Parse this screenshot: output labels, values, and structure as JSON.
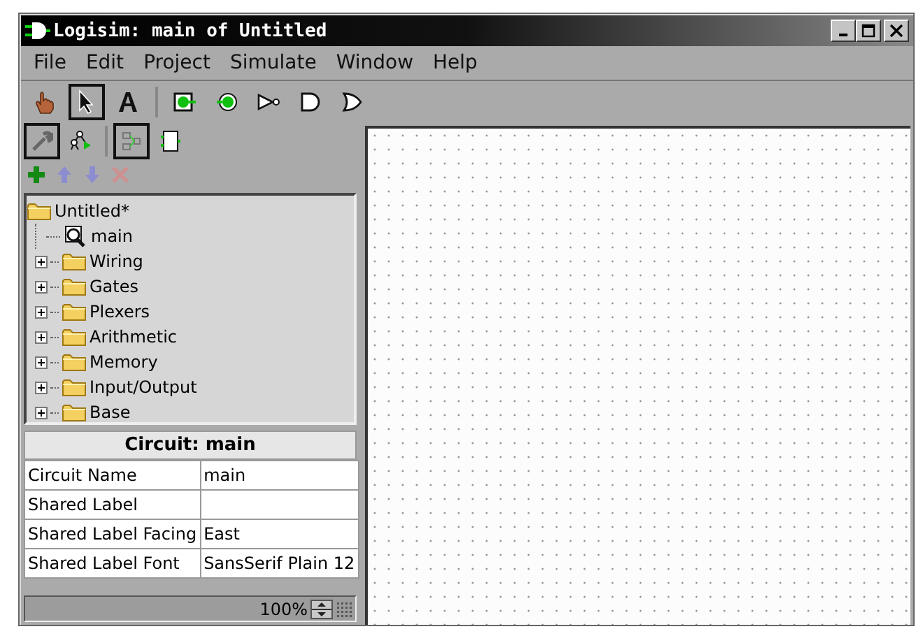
{
  "window": {
    "title": "Logisim: main of Untitled"
  },
  "menu": [
    "File",
    "Edit",
    "Project",
    "Simulate",
    "Window",
    "Help"
  ],
  "toolbar": [
    {
      "kind": "poke",
      "selected": false
    },
    {
      "kind": "select",
      "selected": true
    },
    {
      "kind": "text",
      "selected": false
    },
    {
      "kind": "separator"
    },
    {
      "kind": "input",
      "selected": false
    },
    {
      "kind": "output",
      "selected": false
    },
    {
      "kind": "not",
      "selected": false
    },
    {
      "kind": "and",
      "selected": false
    },
    {
      "kind": "or",
      "selected": false
    }
  ],
  "view_tools": [
    {
      "kind": "wrench",
      "selected": true
    },
    {
      "kind": "hierarchy",
      "selected": false
    },
    {
      "kind": "separator"
    },
    {
      "kind": "layout",
      "selected": true
    },
    {
      "kind": "appearance",
      "selected": false
    }
  ],
  "project_tools": [
    {
      "kind": "add",
      "disabled": false
    },
    {
      "kind": "up",
      "disabled": true
    },
    {
      "kind": "down",
      "disabled": true
    },
    {
      "kind": "remove",
      "disabled": true
    }
  ],
  "tree": {
    "label": "Untitled*",
    "children": [
      {
        "kind": "circuit",
        "label": "main"
      },
      {
        "kind": "library",
        "label": "Wiring",
        "expanded": false
      },
      {
        "kind": "library",
        "label": "Gates",
        "expanded": false
      },
      {
        "kind": "library",
        "label": "Plexers",
        "expanded": false
      },
      {
        "kind": "library",
        "label": "Arithmetic",
        "expanded": false
      },
      {
        "kind": "library",
        "label": "Memory",
        "expanded": false
      },
      {
        "kind": "library",
        "label": "Input/Output",
        "expanded": false
      },
      {
        "kind": "library",
        "label": "Base",
        "expanded": false
      }
    ]
  },
  "attributes": {
    "title": "Circuit: main",
    "rows": [
      {
        "name": "Circuit Name",
        "value": "main"
      },
      {
        "name": "Shared Label"
      },
      {
        "name": "Shared Label Facing",
        "value": "East"
      },
      {
        "name": "Shared Label Font",
        "value": "SansSerif Plain 12"
      }
    ]
  },
  "status": {
    "zoom": "100%"
  }
}
